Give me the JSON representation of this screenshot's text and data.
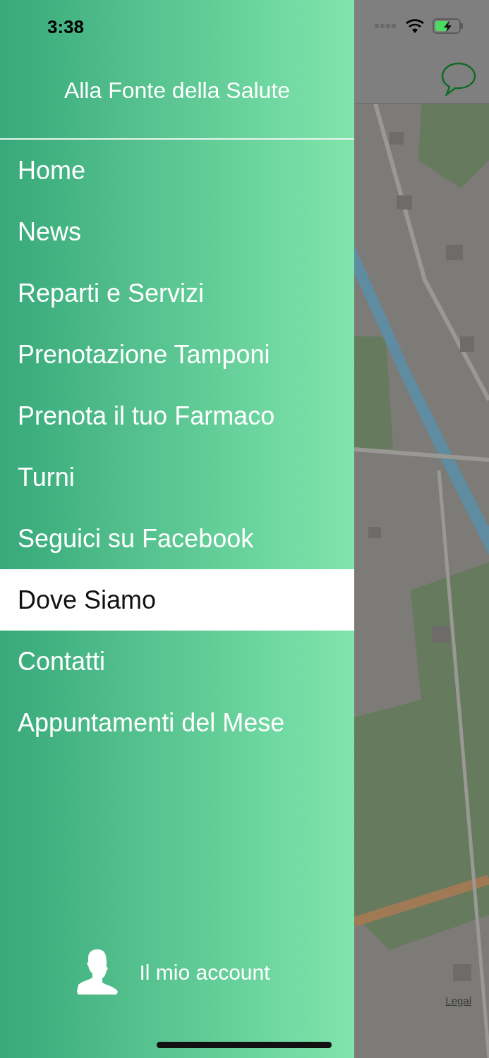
{
  "status_bar": {
    "time": "3:38"
  },
  "drawer": {
    "title": "Alla Fonte della Salute",
    "items": [
      {
        "label": "Home",
        "selected": false
      },
      {
        "label": "News",
        "selected": false
      },
      {
        "label": "Reparti e Servizi",
        "selected": false
      },
      {
        "label": "Prenotazione Tamponi",
        "selected": false
      },
      {
        "label": "Prenota il tuo Farmaco",
        "selected": false
      },
      {
        "label": "Turni",
        "selected": false
      },
      {
        "label": "Seguici su Facebook",
        "selected": false
      },
      {
        "label": "Dove Siamo",
        "selected": true
      },
      {
        "label": "Contatti",
        "selected": false
      },
      {
        "label": "Appuntamenti del Mese",
        "selected": false
      }
    ],
    "account": {
      "label": "Il mio account"
    }
  },
  "map": {
    "kind": "picture",
    "legal_link": "Legal"
  }
}
